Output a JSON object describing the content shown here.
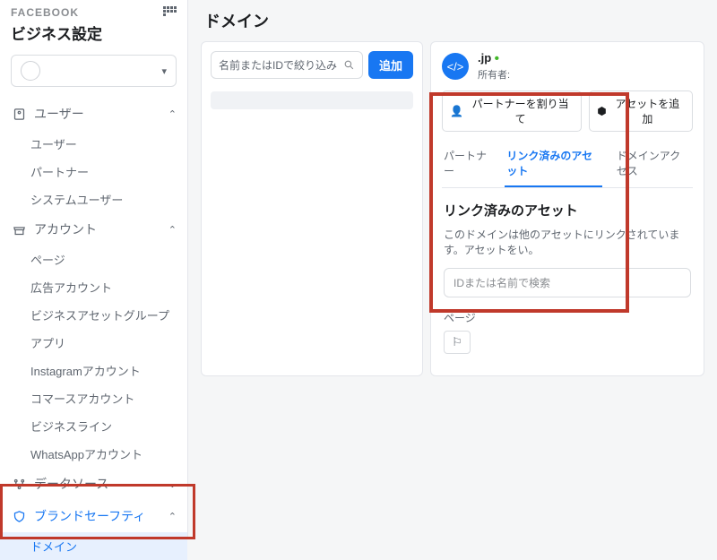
{
  "brand": "FACEBOOK",
  "page_title": "ビジネス設定",
  "main_title": "ドメイン",
  "search": {
    "placeholder": "名前またはIDで絞り込み",
    "add_btn": "追加"
  },
  "sidebar": {
    "sections": [
      {
        "label": "ユーザー",
        "items": [
          "ユーザー",
          "パートナー",
          "システムユーザー"
        ]
      },
      {
        "label": "アカウント",
        "items": [
          "ページ",
          "広告アカウント",
          "ビジネスアセットグループ",
          "アプリ",
          "Instagramアカウント",
          "コマースアカウント",
          "ビジネスライン",
          "WhatsAppアカウント"
        ]
      },
      {
        "label": "データソース",
        "items": []
      },
      {
        "label": "ブランドセーフティ",
        "active": true,
        "items": [
          "ドメイン"
        ]
      }
    ]
  },
  "right": {
    "domain": ".jp",
    "owner_label": "所有者:",
    "btn_partner": "パートナーを割り当て",
    "btn_asset": "アセットを追加",
    "tabs": [
      "パートナー",
      "リンク済みのアセット",
      "ドメインアクセス"
    ],
    "body_title": "リンク済みのアセット",
    "body_desc": "このドメインは他のアセットにリンクされています。アセットをい。",
    "body_search": "IDまたは名前で検索",
    "body_sub": "ページ"
  }
}
